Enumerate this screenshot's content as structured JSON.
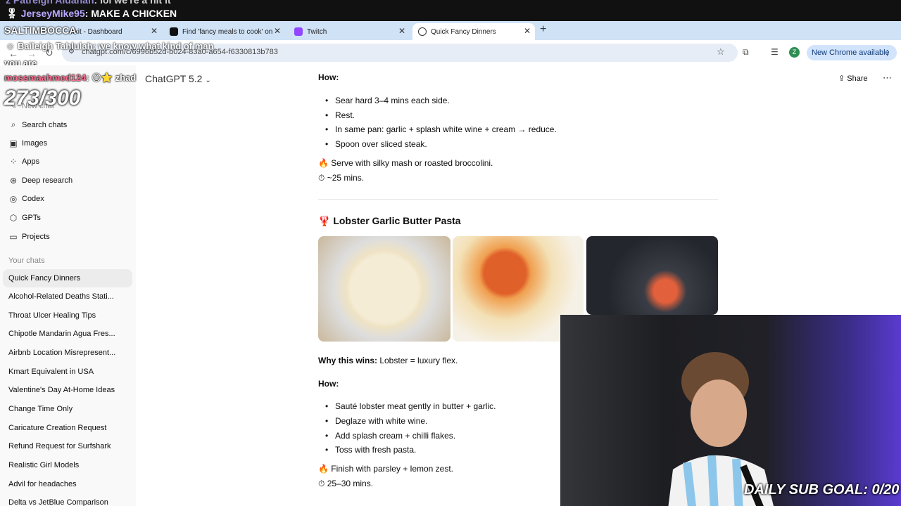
{
  "stream": {
    "chat_line_top": {
      "user": "z Patreigh Aldanan",
      "text": "lol we're a hit it"
    },
    "chat_line_1": {
      "user": "JerseyMike95",
      "text": "MAKE A CHICKEN"
    },
    "chat_overlay_salt": "SALTIMBOCCA",
    "chat_overlay_tahlulah": {
      "user": "Baileigh Tahlulah",
      "text": "we know what kind of man"
    },
    "chat_overlay_you": "you are",
    "chat_overlay_mo": {
      "user": "mossmaahmed124",
      "emote_text": "zhad"
    },
    "counter": "273/300",
    "goal": "DAILY SUB GOAL: 0/20"
  },
  "browser": {
    "tabs": [
      {
        "label": "olkit - Dashboard"
      },
      {
        "label": "Find 'fancy meals to cook' on"
      },
      {
        "label": "Twitch"
      },
      {
        "label": "Quick Fancy Dinners"
      }
    ],
    "url": "chatgpt.com/c/6996b52d-b024-83a0-a654-f6330813b783",
    "new_chrome": "New Chrome available",
    "profile_initial": "Z"
  },
  "chatgpt": {
    "model": "ChatGPT 5.2",
    "share": "Share",
    "nav": [
      {
        "label": "New chat",
        "icon": "pencil-icon"
      },
      {
        "label": "Search chats",
        "icon": "search-icon"
      },
      {
        "label": "Images",
        "icon": "image-icon"
      },
      {
        "label": "Apps",
        "icon": "apps-icon"
      },
      {
        "label": "Deep research",
        "icon": "telescope-icon"
      },
      {
        "label": "Codex",
        "icon": "codex-icon"
      },
      {
        "label": "GPTs",
        "icon": "cube-icon"
      },
      {
        "label": "Projects",
        "icon": "folder-icon"
      }
    ],
    "your_chats_label": "Your chats",
    "chats": [
      "Quick Fancy Dinners",
      "Alcohol-Related Deaths Stati...",
      "Throat Ulcer Healing Tips",
      "Chipotle Mandarin Agua Fres...",
      "Airbnb Location Misrepresent...",
      "Kmart Equivalent in USA",
      "Valentine's Day At-Home Ideas",
      "Change Time Only",
      "Caricature Creation Request",
      "Refund Request for Surfshark",
      "Realistic Girl Models",
      "Advil for headaches",
      "Delta vs JetBlue Comparison"
    ]
  },
  "message": {
    "how_label_1": "How:",
    "steps_1": [
      "Sear hard 3–4 mins each side.",
      "Rest.",
      "In same pan: garlic + splash white wine + cream → reduce.",
      "Spoon over sliced steak."
    ],
    "serve_1": "🔥 Serve with silky mash or roasted broccolini.",
    "time_1": "⏱ ~25 mins.",
    "recipe_title": "🦞 Lobster Garlic Butter Pasta",
    "why_label": "Why this wins:",
    "why_text": " Lobster = luxury flex.",
    "how_label_2": "How:",
    "steps_2": [
      "Sauté lobster meat gently in butter + garlic.",
      "Deglaze with white wine.",
      "Add splash cream + chilli flakes.",
      "Toss with fresh pasta."
    ],
    "finish_2": "🔥 Finish with parsley + lemon zest.",
    "time_2": "⏱ 25–30 mins."
  }
}
